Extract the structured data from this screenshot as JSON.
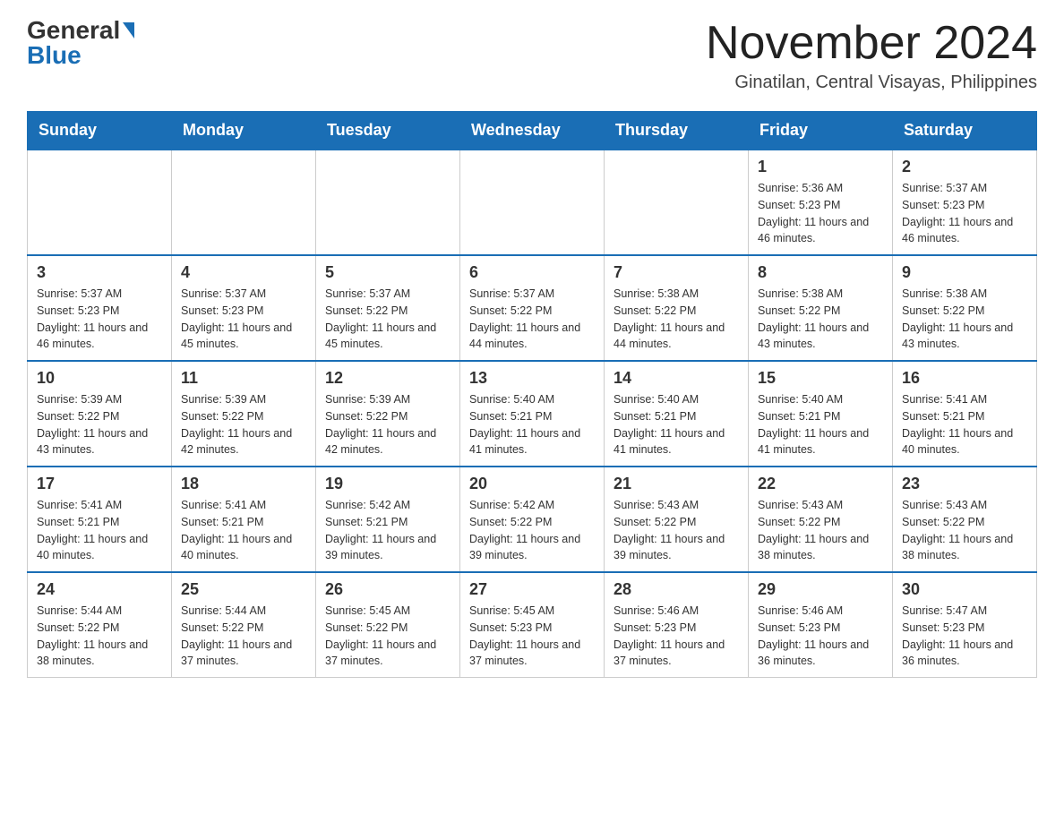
{
  "header": {
    "logo_general": "General",
    "logo_blue": "Blue",
    "month_title": "November 2024",
    "location": "Ginatilan, Central Visayas, Philippines"
  },
  "calendar": {
    "days_of_week": [
      "Sunday",
      "Monday",
      "Tuesday",
      "Wednesday",
      "Thursday",
      "Friday",
      "Saturday"
    ],
    "weeks": [
      [
        {
          "day": "",
          "info": ""
        },
        {
          "day": "",
          "info": ""
        },
        {
          "day": "",
          "info": ""
        },
        {
          "day": "",
          "info": ""
        },
        {
          "day": "",
          "info": ""
        },
        {
          "day": "1",
          "info": "Sunrise: 5:36 AM\nSunset: 5:23 PM\nDaylight: 11 hours and 46 minutes."
        },
        {
          "day": "2",
          "info": "Sunrise: 5:37 AM\nSunset: 5:23 PM\nDaylight: 11 hours and 46 minutes."
        }
      ],
      [
        {
          "day": "3",
          "info": "Sunrise: 5:37 AM\nSunset: 5:23 PM\nDaylight: 11 hours and 46 minutes."
        },
        {
          "day": "4",
          "info": "Sunrise: 5:37 AM\nSunset: 5:23 PM\nDaylight: 11 hours and 45 minutes."
        },
        {
          "day": "5",
          "info": "Sunrise: 5:37 AM\nSunset: 5:22 PM\nDaylight: 11 hours and 45 minutes."
        },
        {
          "day": "6",
          "info": "Sunrise: 5:37 AM\nSunset: 5:22 PM\nDaylight: 11 hours and 44 minutes."
        },
        {
          "day": "7",
          "info": "Sunrise: 5:38 AM\nSunset: 5:22 PM\nDaylight: 11 hours and 44 minutes."
        },
        {
          "day": "8",
          "info": "Sunrise: 5:38 AM\nSunset: 5:22 PM\nDaylight: 11 hours and 43 minutes."
        },
        {
          "day": "9",
          "info": "Sunrise: 5:38 AM\nSunset: 5:22 PM\nDaylight: 11 hours and 43 minutes."
        }
      ],
      [
        {
          "day": "10",
          "info": "Sunrise: 5:39 AM\nSunset: 5:22 PM\nDaylight: 11 hours and 43 minutes."
        },
        {
          "day": "11",
          "info": "Sunrise: 5:39 AM\nSunset: 5:22 PM\nDaylight: 11 hours and 42 minutes."
        },
        {
          "day": "12",
          "info": "Sunrise: 5:39 AM\nSunset: 5:22 PM\nDaylight: 11 hours and 42 minutes."
        },
        {
          "day": "13",
          "info": "Sunrise: 5:40 AM\nSunset: 5:21 PM\nDaylight: 11 hours and 41 minutes."
        },
        {
          "day": "14",
          "info": "Sunrise: 5:40 AM\nSunset: 5:21 PM\nDaylight: 11 hours and 41 minutes."
        },
        {
          "day": "15",
          "info": "Sunrise: 5:40 AM\nSunset: 5:21 PM\nDaylight: 11 hours and 41 minutes."
        },
        {
          "day": "16",
          "info": "Sunrise: 5:41 AM\nSunset: 5:21 PM\nDaylight: 11 hours and 40 minutes."
        }
      ],
      [
        {
          "day": "17",
          "info": "Sunrise: 5:41 AM\nSunset: 5:21 PM\nDaylight: 11 hours and 40 minutes."
        },
        {
          "day": "18",
          "info": "Sunrise: 5:41 AM\nSunset: 5:21 PM\nDaylight: 11 hours and 40 minutes."
        },
        {
          "day": "19",
          "info": "Sunrise: 5:42 AM\nSunset: 5:21 PM\nDaylight: 11 hours and 39 minutes."
        },
        {
          "day": "20",
          "info": "Sunrise: 5:42 AM\nSunset: 5:22 PM\nDaylight: 11 hours and 39 minutes."
        },
        {
          "day": "21",
          "info": "Sunrise: 5:43 AM\nSunset: 5:22 PM\nDaylight: 11 hours and 39 minutes."
        },
        {
          "day": "22",
          "info": "Sunrise: 5:43 AM\nSunset: 5:22 PM\nDaylight: 11 hours and 38 minutes."
        },
        {
          "day": "23",
          "info": "Sunrise: 5:43 AM\nSunset: 5:22 PM\nDaylight: 11 hours and 38 minutes."
        }
      ],
      [
        {
          "day": "24",
          "info": "Sunrise: 5:44 AM\nSunset: 5:22 PM\nDaylight: 11 hours and 38 minutes."
        },
        {
          "day": "25",
          "info": "Sunrise: 5:44 AM\nSunset: 5:22 PM\nDaylight: 11 hours and 37 minutes."
        },
        {
          "day": "26",
          "info": "Sunrise: 5:45 AM\nSunset: 5:22 PM\nDaylight: 11 hours and 37 minutes."
        },
        {
          "day": "27",
          "info": "Sunrise: 5:45 AM\nSunset: 5:23 PM\nDaylight: 11 hours and 37 minutes."
        },
        {
          "day": "28",
          "info": "Sunrise: 5:46 AM\nSunset: 5:23 PM\nDaylight: 11 hours and 37 minutes."
        },
        {
          "day": "29",
          "info": "Sunrise: 5:46 AM\nSunset: 5:23 PM\nDaylight: 11 hours and 36 minutes."
        },
        {
          "day": "30",
          "info": "Sunrise: 5:47 AM\nSunset: 5:23 PM\nDaylight: 11 hours and 36 minutes."
        }
      ]
    ]
  }
}
